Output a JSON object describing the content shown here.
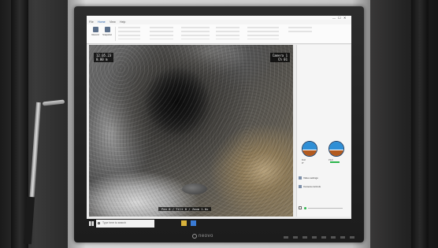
{
  "window": {
    "title": "",
    "controls": [
      "—",
      "☐",
      "✕"
    ]
  },
  "ribbon": {
    "tabs": [
      "File",
      "Home",
      "View",
      "Help"
    ],
    "active_tab": "Home",
    "buttons": [
      {
        "label": "Record",
        "icon": "record-icon"
      },
      {
        "label": "Snapshot",
        "icon": "camera-icon"
      }
    ]
  },
  "video": {
    "osd_top_left": [
      "12.05.23",
      "0.00 m"
    ],
    "osd_top_right": [
      "Camera 1",
      "Ch 01"
    ],
    "osd_bottom": "Pan 0 / Tilt 0 / Zoom 1.0x"
  },
  "panel": {
    "gauges": [
      {
        "label": "Roll",
        "value": "0°",
        "icon": "attitude-gauge-icon"
      },
      {
        "label": "Pitch",
        "value": "0°",
        "icon": "attitude-gauge-icon"
      }
    ],
    "links": [
      {
        "label": "Video settings",
        "icon": "video-icon"
      },
      {
        "label": "Camera controls",
        "icon": "camera-icon"
      }
    ],
    "checkbox_label": ""
  },
  "taskbar": {
    "search_placeholder": "Type here to search",
    "tray_time": "",
    "apps": [
      "file-explorer-icon",
      "app-icon"
    ]
  },
  "monitor": {
    "brand": "neovo"
  },
  "colors": {
    "accent": "#1e5aa8",
    "gauge_sky": "#2f8fd6",
    "gauge_ground": "#b25a1f",
    "status_green": "#2bb54b",
    "taskbar": "#1d1d1d"
  }
}
